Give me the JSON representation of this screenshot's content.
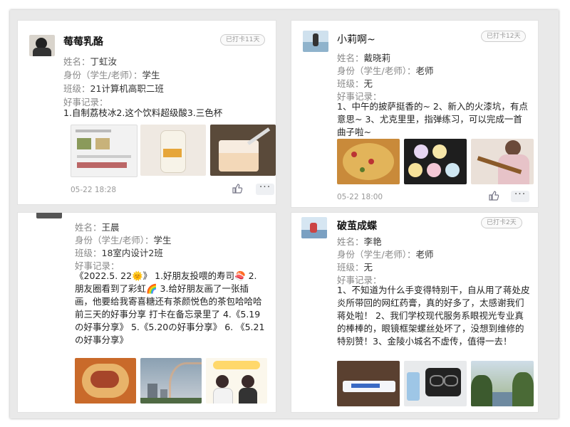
{
  "posts": [
    {
      "username": "莓莓乳酪",
      "badge": "已打卡11天",
      "name_label": "姓名：",
      "name": "丁虹汝",
      "role_label": "身份（学生/老师）：",
      "role": "学生",
      "class_label": "班级：",
      "class": "21计算机高职二班",
      "record_label": "好事记录：",
      "content": "1.自制荔枝冰2.这个饮料超级酸3.三色杯",
      "time": "05-22 18:28",
      "photos": [
        "screenshot-photo",
        "drink-bottle-photo",
        "three-color-cup-photo"
      ]
    },
    {
      "username": "小莉啊~",
      "badge": "已打卡12天",
      "name_label": "姓名：",
      "name": "戴晓莉",
      "role_label": "身份（学生/老师）：",
      "role": "老师",
      "class_label": "班级：",
      "class": "无",
      "record_label": "好事记录：",
      "content": "1、中午的披萨挺香的~ 2、新入的火漆坑，有点意思~ 3、尤克里里，指弹练习，可以完成一首曲子啦~",
      "time": "05-22 18:00",
      "photos": [
        "pizza-photo",
        "wax-seal-photo",
        "ukulele-photo"
      ]
    },
    {
      "name_label": "姓名：",
      "name": "王晨",
      "role_label": "身份（学生/老师）：",
      "role": "学生",
      "class_label": "班级：",
      "class": "18室内设计2班",
      "record_label": "好事记录：",
      "content": "《2022.5. 22🌞》 1.好朋友投喂的寿司🍣 2.朋友圈看到了彩虹🌈 3.给好朋友画了一张插画，他要给我寄喜糖还有茶颜悦色的茶包哈哈哈 前三天的好事分享 打卡在备忘录里了 4.《5.19の好事分享》 5.《5.20の好事分享》 6. 《5.21の好事分享》",
      "photos": [
        "sushi-photo",
        "rainbow-photo",
        "illustration-photo"
      ]
    },
    {
      "username": "破茧成蝶",
      "badge": "已打卡2天",
      "name_label": "姓名：",
      "name": "李艳",
      "role_label": "身份（学生/老师）：",
      "role": "老师",
      "class_label": "班级：",
      "class": "无",
      "record_label": "好事记录：",
      "content": "1、不知道为什么手变得特别干，自从用了蒋处皮炎所带回的网红药膏，真的好多了，太感谢我们蒋处啦！ 2、我们学校现代服务系眼视光专业真的棒棒的，眼镜框架螺丝处坏了，没想到维修的特别赞！3、金陵小城名不虚传，值得一去！",
      "photos": [
        "ointment-photo",
        "glasses-photo",
        "garden-photo"
      ]
    }
  ]
}
